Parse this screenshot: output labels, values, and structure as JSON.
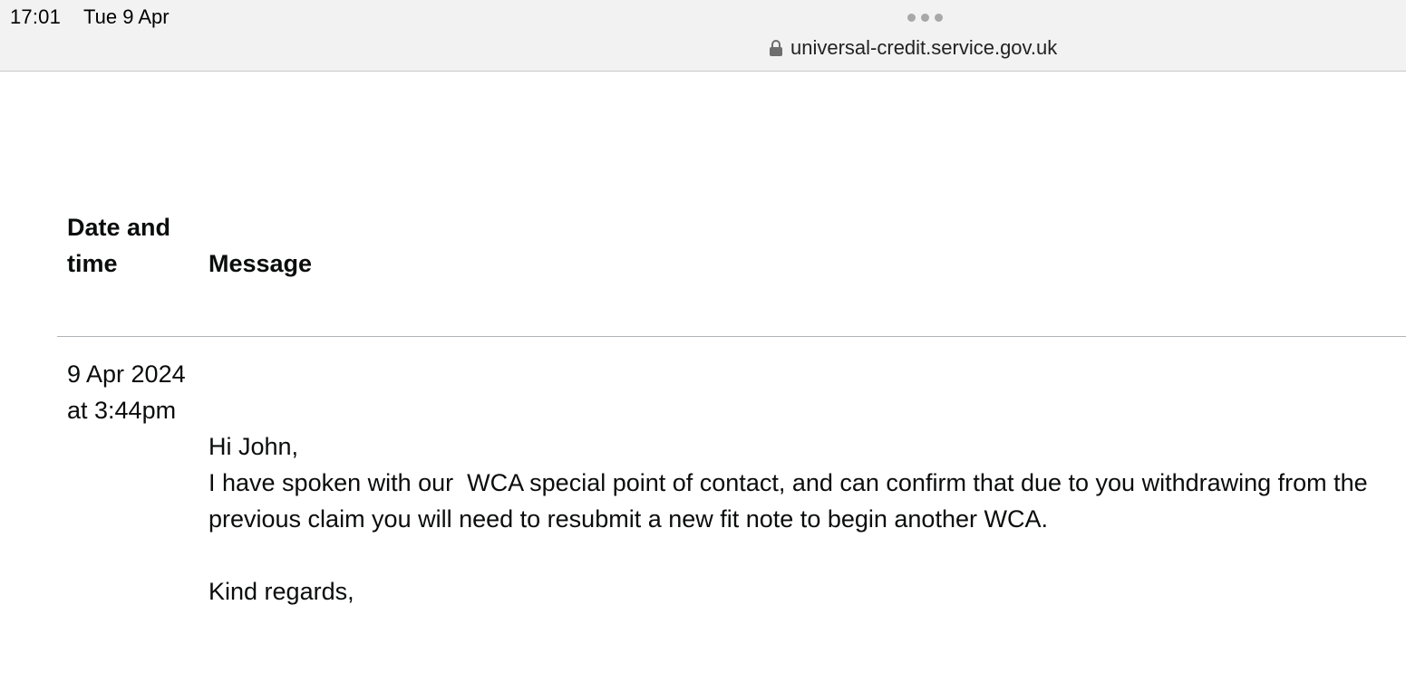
{
  "status_bar": {
    "time": "17:01",
    "date": "Tue 9 Apr"
  },
  "address_bar": {
    "url": "universal-credit.service.gov.uk",
    "icon": "lock-icon"
  },
  "table": {
    "headers": {
      "date_time": "Date and time",
      "message": "Message"
    },
    "rows": [
      {
        "date_time": "9 Apr 2024 at 3:44pm",
        "message": {
          "greeting": "Hi John,",
          "body": "I have spoken with our  WCA special point of contact, and can confirm that due to you withdrawing from the previous claim you will need to resubmit a new fit note to begin another WCA.",
          "sign_off": "Kind regards,"
        }
      }
    ]
  }
}
